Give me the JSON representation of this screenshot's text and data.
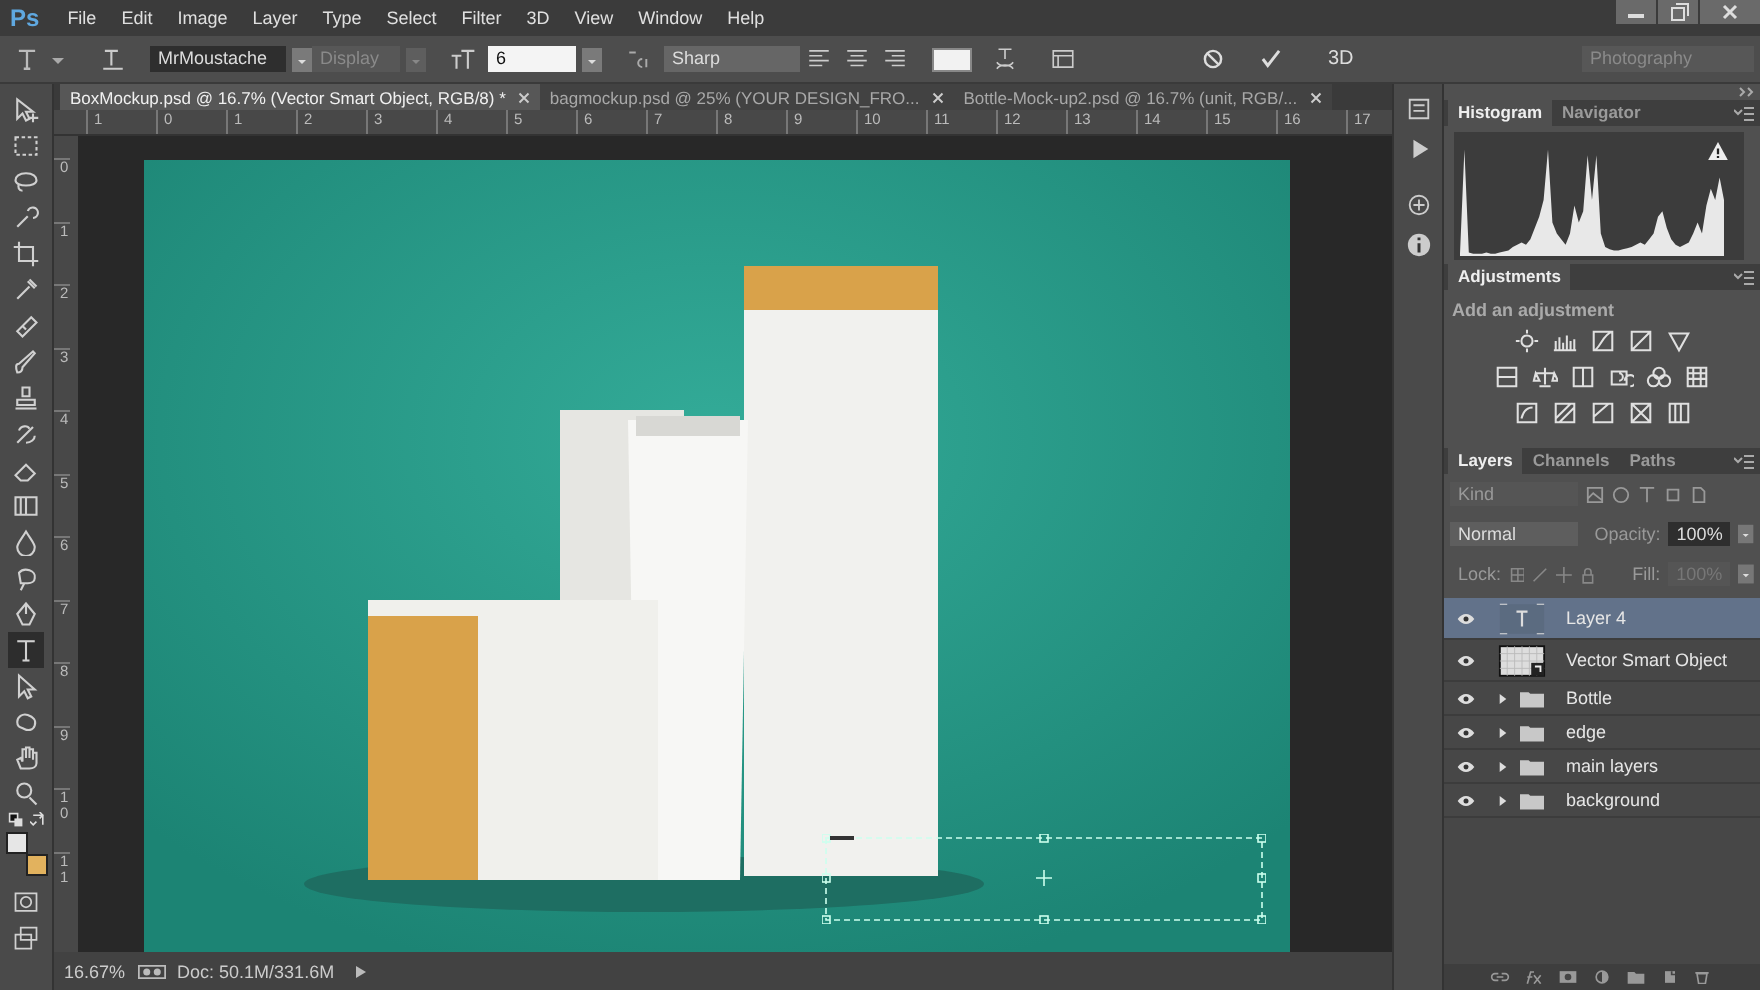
{
  "app_logo": "Ps",
  "menu": [
    "File",
    "Edit",
    "Image",
    "Layer",
    "Type",
    "Select",
    "Filter",
    "3D",
    "View",
    "Window",
    "Help"
  ],
  "options_bar": {
    "font_family": "MrMoustache",
    "font_style": {
      "value": "Display",
      "disabled": true
    },
    "font_size": "6",
    "antialiasing": "Sharp",
    "button_3d": "3D",
    "workspace": {
      "value": "Photography",
      "disabled": true
    }
  },
  "document_tabs": [
    {
      "title": "BoxMockup.psd @ 16.7% (Vector Smart Object, RGB/8) *",
      "selected": true
    },
    {
      "title": "bagmockup.psd @ 25% (YOUR DESIGN_FRO...",
      "selected": false
    },
    {
      "title": "Bottle-Mock-up2.psd @ 16.7% (unit, RGB/...",
      "selected": false
    }
  ],
  "rulers": {
    "horizontal": [
      "1",
      "0",
      "1",
      "2",
      "3",
      "4",
      "5",
      "6",
      "7",
      "8",
      "9",
      "10",
      "11",
      "12",
      "13",
      "14",
      "15",
      "16",
      "17"
    ],
    "vertical": [
      "0",
      "1",
      "2",
      "3",
      "4",
      "5",
      "6",
      "7",
      "8",
      "9",
      "10",
      "11"
    ]
  },
  "tools": [
    {
      "kind": "move",
      "selected": false
    },
    {
      "kind": "marquee",
      "selected": false
    },
    {
      "kind": "lasso",
      "selected": false
    },
    {
      "kind": "quick-select",
      "selected": false
    },
    {
      "kind": "crop",
      "selected": false
    },
    {
      "kind": "eyedropper",
      "selected": false
    },
    {
      "kind": "healing",
      "selected": false
    },
    {
      "kind": "brush",
      "selected": false
    },
    {
      "kind": "stamp",
      "selected": false
    },
    {
      "kind": "history-brush",
      "selected": false
    },
    {
      "kind": "eraser",
      "selected": false
    },
    {
      "kind": "gradient",
      "selected": false
    },
    {
      "kind": "blur",
      "selected": false
    },
    {
      "kind": "dodge",
      "selected": false
    },
    {
      "kind": "pen",
      "selected": false
    },
    {
      "kind": "type",
      "selected": true
    },
    {
      "kind": "path-select",
      "selected": false
    },
    {
      "kind": "shape",
      "selected": false
    },
    {
      "kind": "hand",
      "selected": false
    },
    {
      "kind": "zoom",
      "selected": false
    }
  ],
  "swatches": [
    {
      "color": "#e6e6e6"
    },
    {
      "color": "#e2b25e"
    }
  ],
  "status_bar": {
    "zoom": "16.67%",
    "doc_size": "Doc: 50.1M/331.6M"
  },
  "histogram_panel": {
    "tabs": [
      {
        "label": "Histogram",
        "selected": true
      },
      {
        "label": "Navigator",
        "selected": false
      }
    ]
  },
  "adjustments_panel": {
    "title": "Adjustments",
    "hint": "Add an adjustment"
  },
  "layers_panel": {
    "tabs": [
      {
        "label": "Layers",
        "selected": true
      },
      {
        "label": "Channels",
        "selected": false
      },
      {
        "label": "Paths",
        "selected": false
      }
    ],
    "filter": "Kind",
    "blend_mode": "Normal",
    "opacity_label": "Opacity:",
    "opacity": "100%",
    "lock_label": "Lock:",
    "fill_label": "Fill:",
    "fill": {
      "value": "100%",
      "disabled": true
    },
    "layers": [
      {
        "name": "Layer 4",
        "kind": "text",
        "selected": true,
        "visible": true
      },
      {
        "name": "Vector Smart Object",
        "kind": "smart",
        "selected": false,
        "visible": true
      },
      {
        "name": "Bottle",
        "kind": "group",
        "selected": false,
        "visible": true,
        "expanded": false
      },
      {
        "name": "edge",
        "kind": "group",
        "selected": false,
        "visible": true,
        "expanded": false
      },
      {
        "name": "main layers",
        "kind": "group",
        "selected": false,
        "visible": true,
        "expanded": false
      },
      {
        "name": "background",
        "kind": "group",
        "selected": false,
        "visible": true,
        "expanded": false
      }
    ]
  }
}
